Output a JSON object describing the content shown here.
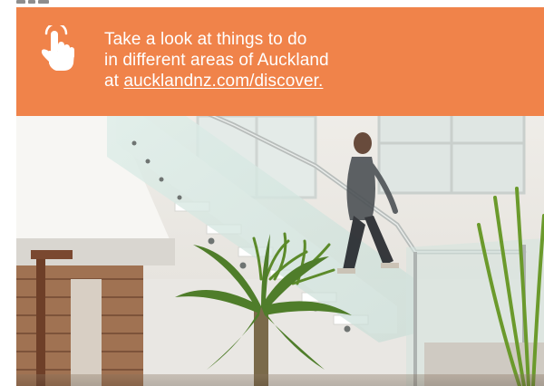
{
  "banner": {
    "line1": "Take a look at things to do",
    "line2": "in different areas of Auckland",
    "line3_prefix": "at ",
    "link_text": "aucklandnz.com/discover."
  },
  "icons": {
    "banner_icon": "pointing-hand-icon"
  },
  "colors": {
    "banner_background": "#f0834a",
    "banner_text": "#ffffff",
    "wall": "#eceae6",
    "wood": "#8a5a3c"
  }
}
